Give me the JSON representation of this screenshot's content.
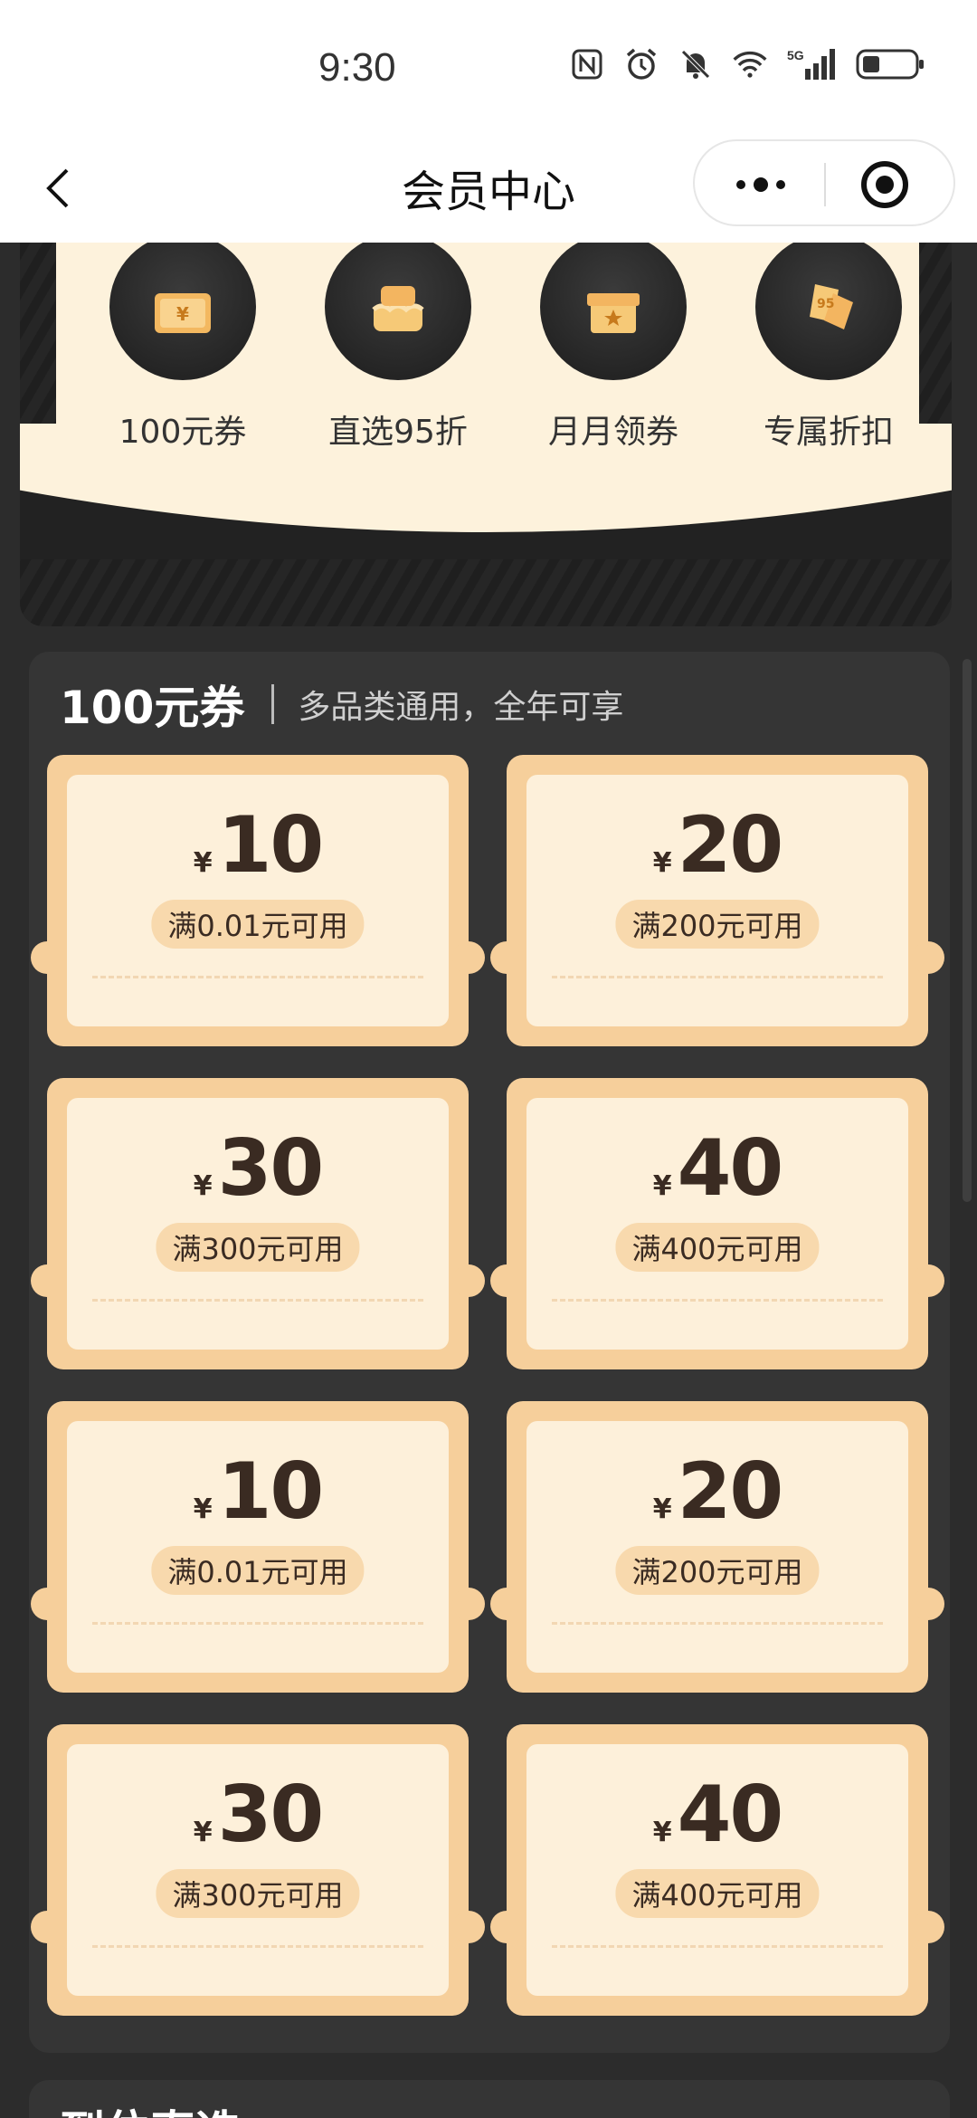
{
  "status": {
    "time": "9:30"
  },
  "nav": {
    "title": "会员中心"
  },
  "benefits": [
    {
      "label": "100元券",
      "icon": "coupon-ticket-icon"
    },
    {
      "label": "直选95折",
      "icon": "gift-basket-icon"
    },
    {
      "label": "月月领券",
      "icon": "star-box-icon"
    },
    {
      "label": "专属折扣",
      "icon": "discount-tag-icon"
    }
  ],
  "coupons_section": {
    "title": "100元券",
    "subtitle": "多品类通用，全年可享",
    "currency": "¥",
    "coupons": [
      {
        "amount": "10",
        "condition": "满0.01元可用"
      },
      {
        "amount": "20",
        "condition": "满200元可用"
      },
      {
        "amount": "30",
        "condition": "满300元可用"
      },
      {
        "amount": "40",
        "condition": "满400元可用"
      },
      {
        "amount": "10",
        "condition": "满0.01元可用"
      },
      {
        "amount": "20",
        "condition": "满200元可用"
      },
      {
        "amount": "30",
        "condition": "满300元可用"
      },
      {
        "amount": "40",
        "condition": "满400元可用"
      }
    ]
  },
  "next_section": {
    "title": "到位直选"
  },
  "colors": {
    "gold": "#f6cf9b",
    "cream": "#fdf0da",
    "dark": "#2c2c2c",
    "brown": "#3a2b22"
  }
}
